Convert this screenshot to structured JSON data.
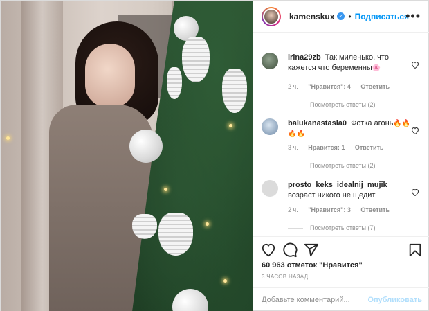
{
  "header": {
    "username": "kamenskux",
    "verified_icon": "verified-badge-icon",
    "separator": "•",
    "follow_label": "Подписаться",
    "more_icon": "more-options-icon"
  },
  "comments": [
    {
      "username": "irina29zb",
      "text": "Так миленько, что кажется что беременны",
      "emoji": "🌸",
      "time": "2 ч.",
      "likes": "\"Нравится\": 4",
      "reply_label": "Ответить",
      "replies_label": "Посмотреть ответы (2)"
    },
    {
      "username": "balukanastasia0",
      "text": "Фотка агонь",
      "emoji": "🔥🔥🔥🔥",
      "time": "3 ч.",
      "likes": "Нравится: 1",
      "reply_label": "Ответить",
      "replies_label": "Посмотреть ответы (2)"
    },
    {
      "username": "prosto_keks_idealnij_mujik",
      "text": "возраст никого не щедит",
      "emoji": "",
      "time": "2 ч.",
      "likes": "\"Нравится\": 3",
      "reply_label": "Ответить",
      "replies_label": "Посмотреть ответы (7)"
    }
  ],
  "actions": {
    "like_icon": "heart-icon",
    "comment_icon": "comment-icon",
    "share_icon": "share-icon",
    "save_icon": "bookmark-icon"
  },
  "likes_text": "60 963 отметок \"Нравится\"",
  "posted_time": "3 ЧАСОВ НАЗАД",
  "comment_box": {
    "placeholder": "Добавьте комментарий...",
    "publish_label": "Опубликовать"
  },
  "colors": {
    "accent": "#0095f6",
    "publish_disabled": "#b2dffc",
    "muted_text": "#8e8e8e"
  }
}
